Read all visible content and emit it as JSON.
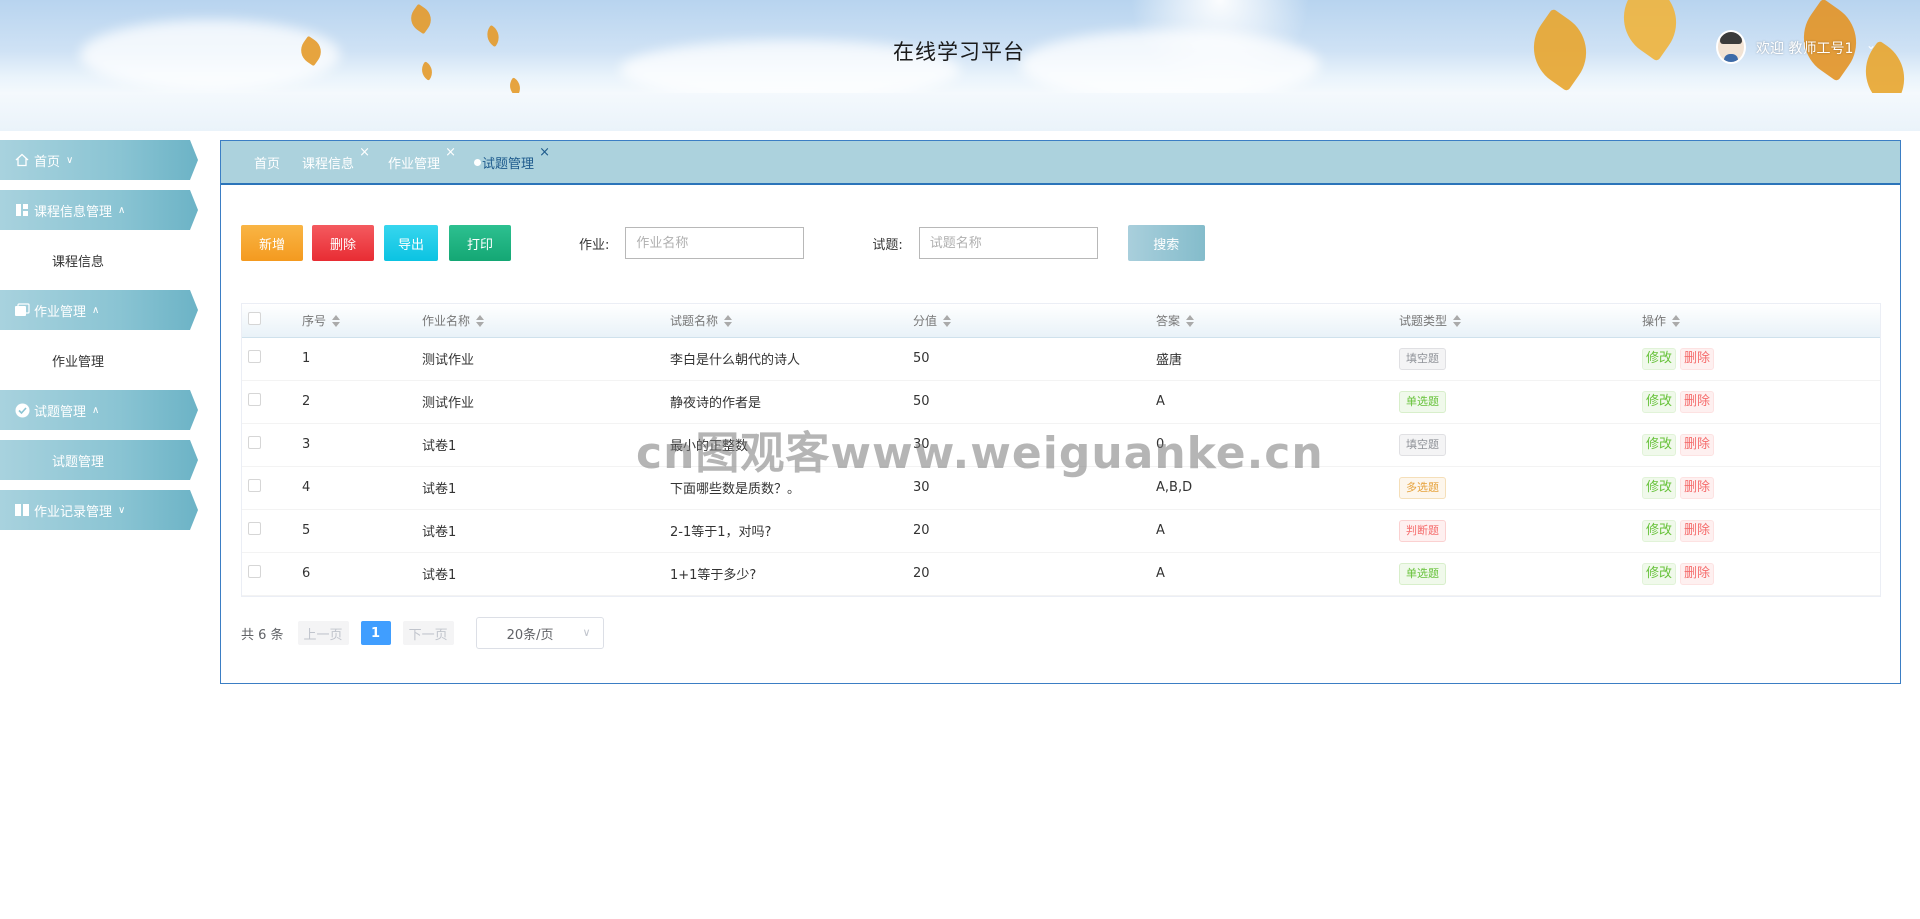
{
  "header": {
    "site_title": "在线学习平台",
    "welcome": "欢迎 教师工号1"
  },
  "sidebar": {
    "items": [
      {
        "label": "首页",
        "icon": "home-icon",
        "expanded": false
      },
      {
        "label": "课程信息管理",
        "icon": "grid-icon",
        "expanded": true,
        "children": [
          {
            "label": "课程信息",
            "active": false
          }
        ]
      },
      {
        "label": "作业管理",
        "icon": "folders-icon",
        "expanded": true,
        "children": [
          {
            "label": "作业管理",
            "active": false
          }
        ]
      },
      {
        "label": "试题管理",
        "icon": "check-circle-icon",
        "expanded": true,
        "children": [
          {
            "label": "试题管理",
            "active": true
          }
        ]
      },
      {
        "label": "作业记录管理",
        "icon": "book-icon",
        "expanded": false
      }
    ]
  },
  "tabs": [
    {
      "label": "首页",
      "closable": false,
      "active": false
    },
    {
      "label": "课程信息",
      "closable": true,
      "active": false
    },
    {
      "label": "作业管理",
      "closable": true,
      "active": false
    },
    {
      "label": "试题管理",
      "closable": true,
      "active": true
    }
  ],
  "toolbar": {
    "add_label": "新增",
    "delete_label": "删除",
    "export_label": "导出",
    "print_label": "打印"
  },
  "filters": {
    "homework_label": "作业:",
    "homework_placeholder": "作业名称",
    "question_label": "试题:",
    "question_placeholder": "试题名称",
    "search_label": "搜索"
  },
  "table": {
    "columns": [
      "序号",
      "作业名称",
      "试题名称",
      "分值",
      "答案",
      "试题类型",
      "操作"
    ],
    "rows": [
      {
        "no": "1",
        "homework": "测试作业",
        "question": "李白是什么朝代的诗人",
        "score": "50",
        "answer": "盛唐",
        "type": "填空题",
        "type_style": "fill"
      },
      {
        "no": "2",
        "homework": "测试作业",
        "question": "静夜诗的作者是",
        "score": "50",
        "answer": "A",
        "type": "单选题",
        "type_style": "single"
      },
      {
        "no": "3",
        "homework": "试卷1",
        "question": "最小的正整数",
        "score": "30",
        "answer": "0",
        "type": "填空题",
        "type_style": "fill"
      },
      {
        "no": "4",
        "homework": "试卷1",
        "question": "下面哪些数是质数？。",
        "score": "30",
        "answer": "A,B,D",
        "type": "多选题",
        "type_style": "multi"
      },
      {
        "no": "5",
        "homework": "试卷1",
        "question": "2-1等于1，对吗?",
        "score": "20",
        "answer": "A",
        "type": "判断题",
        "type_style": "judge"
      },
      {
        "no": "6",
        "homework": "试卷1",
        "question": "1+1等于多少?",
        "score": "20",
        "answer": "A",
        "type": "单选题",
        "type_style": "single"
      }
    ],
    "edit_label": "修改",
    "delete_label": "删除"
  },
  "pagination": {
    "total": "共 6 条",
    "prev": "上一页",
    "current": "1",
    "next": "下一页",
    "page_size": "20条/页"
  },
  "watermark": "cn图观客www.weiguanke.cn"
}
